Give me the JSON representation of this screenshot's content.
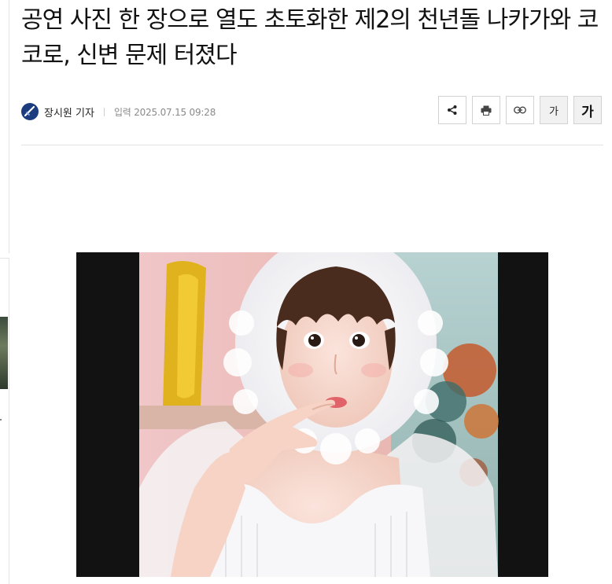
{
  "article": {
    "headline": "공연 사진 한 장으로 열도 초토화한 제2의 천년돌 나카가와 코코로, 신변 문제 터졌다",
    "reporter": "장시원 기자",
    "published": "입력 2025.07.15 09:28"
  },
  "toolbar": {
    "share_icon": "share-icon",
    "print_icon": "print-icon",
    "link_icon": "link-icon",
    "font_small_label": "가",
    "font_large_label": "가"
  },
  "colors": {
    "headline": "#111111",
    "meta": "#8a8a8a",
    "avatar": "#1c3c80",
    "border": "#d2d2d2"
  }
}
